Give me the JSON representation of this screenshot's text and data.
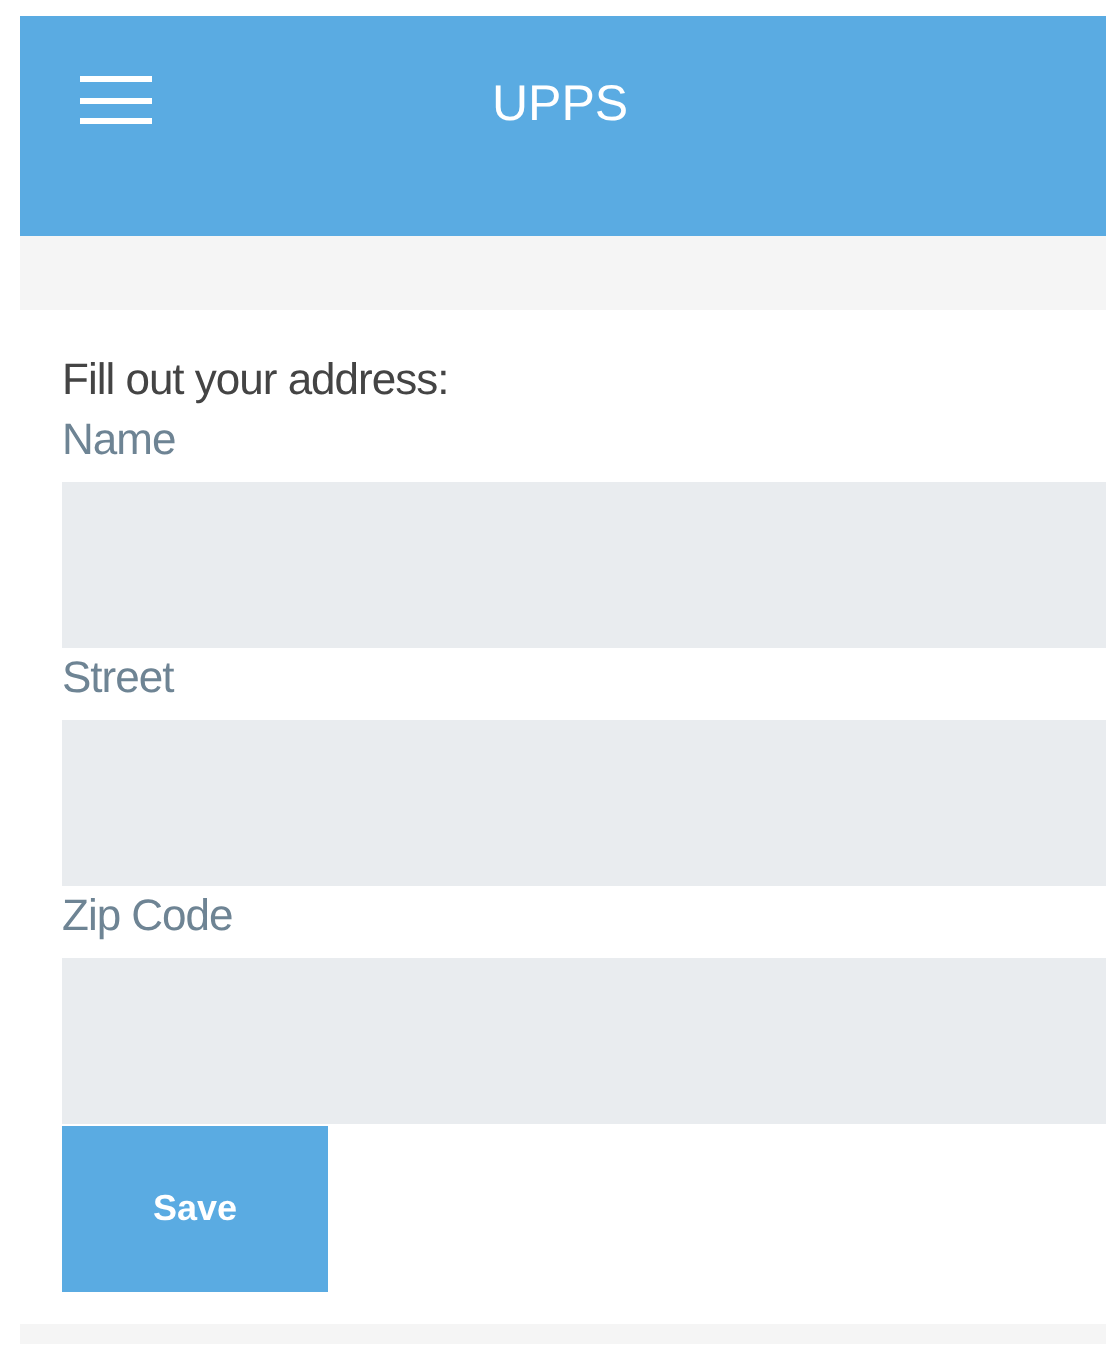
{
  "app_bar": {
    "title": "UPPS"
  },
  "form": {
    "intro": "Fill out your address:",
    "fields": [
      {
        "label": "Name"
      },
      {
        "label": "Street"
      },
      {
        "label": "Zip Code"
      }
    ],
    "save_button": "Save"
  }
}
